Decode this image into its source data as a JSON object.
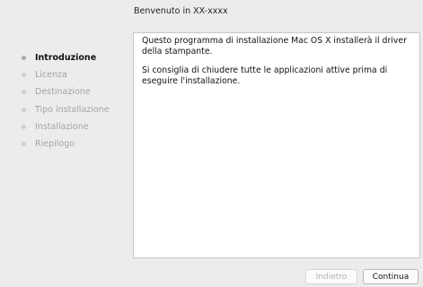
{
  "header": {
    "title": "Benvenuto in XX-xxxx"
  },
  "steps": [
    {
      "label": "Introduzione"
    },
    {
      "label": "Licenza"
    },
    {
      "label": "Destinazione"
    },
    {
      "label": "Tipo installazione"
    },
    {
      "label": "Installazione"
    },
    {
      "label": "Riepilogo"
    }
  ],
  "content": {
    "paragraphs": [
      "Questo programma di installazione Mac OS X installerà il driver della stampante.",
      "Si consiglia di chiudere tutte le applicazioni attive prima di eseguire l'installazione."
    ]
  },
  "buttons": {
    "back": "Indietro",
    "continue": "Continua"
  }
}
